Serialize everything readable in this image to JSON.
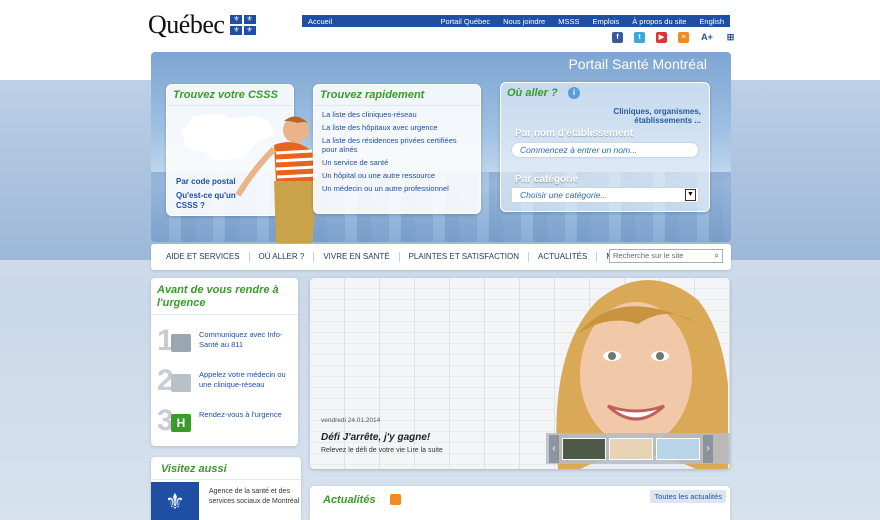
{
  "header": {
    "logo_text": "Québec",
    "top_nav": {
      "home": "Accueil",
      "links": [
        "Portail Québec",
        "Nous joindre",
        "MSSS",
        "Emplois",
        "À propos du site",
        "English"
      ]
    },
    "social": [
      "facebook-icon",
      "twitter-icon",
      "youtube-icon",
      "rss-icon",
      "A+",
      "sitemap-icon"
    ]
  },
  "hero": {
    "title": "Portail Santé Montréal",
    "csss": {
      "heading": "Trouvez votre CSSS",
      "link_postal": "Par code postal",
      "link_what": "Qu'est-ce qu'un CSSS ?"
    },
    "rapide": {
      "heading": "Trouvez rapidement",
      "items": [
        "La liste des cliniques-réseau",
        "La liste des hôpitaux avec urgence",
        "La liste des résidences privées certifiées pour aînés",
        "Un service de santé",
        "Un hôpital ou une autre ressource",
        "Un médecin ou un autre professionnel"
      ]
    },
    "ou_aller": {
      "heading": "Où aller ?",
      "subtitle": "Cliniques, organismes, établissements ...",
      "label_name": "Par nom d'établissement",
      "placeholder_name": "Commencez à entrer un nom...",
      "label_cat": "Par catégorie",
      "select_value": "Choisir une catégorie..."
    }
  },
  "main_nav": {
    "items": [
      "AIDE ET SERVICES",
      "OÙ ALLER ?",
      "VIVRE EN SANTÉ",
      "PLAINTES ET SATISFACTION",
      "ACTUALITÉS",
      "MÉDIAS"
    ],
    "search_placeholder": "Recherche sur le site"
  },
  "urgence": {
    "heading": "Avant de vous rendre à l'urgence",
    "steps": [
      {
        "num": "1",
        "text": "Communiquez avec Info-Santé au 811"
      },
      {
        "num": "2",
        "text": "Appelez votre médecin ou une clinique-réseau"
      },
      {
        "num": "3",
        "text": "Rendez-vous à l'urgence"
      }
    ]
  },
  "visit": {
    "heading": "Visitez aussi",
    "text": "Agence de la santé et des services sociaux de Montréal"
  },
  "feature": {
    "date": "vendredi 24.01.2014",
    "title": "Défi J'arrête, j'y gagne!",
    "subtitle": "Relevez le défi de votre vie Lire la suite"
  },
  "news": {
    "heading": "Actualités",
    "all_link": "Toutes les actualités"
  },
  "colors": {
    "brand_blue": "#1f4fa3",
    "accent_green": "#3a9a2a"
  }
}
